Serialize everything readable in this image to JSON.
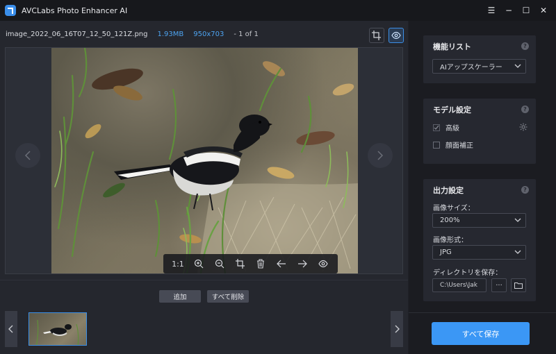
{
  "app": {
    "title": "AVCLabs Photo Enhancer AI"
  },
  "window": {
    "menu": "☰",
    "minimize": "−",
    "maximize": "☐",
    "close": "✕"
  },
  "file": {
    "name": "image_2022_06_16T07_12_50_121Z.png",
    "size": "1.93MB",
    "dimensions": "950x703",
    "count": "- 1 of 1"
  },
  "toolbar": {
    "ratio": "1:1"
  },
  "actions": {
    "add": "追加",
    "delete_all": "すべて削除"
  },
  "panel": {
    "features": {
      "title": "機能リスト",
      "help": "?",
      "selected": "AIアップスケーラー"
    },
    "model": {
      "title": "モデル設定",
      "help": "?",
      "high": "高級",
      "face": "顔面補正"
    },
    "output": {
      "title": "出力設定",
      "help": "?",
      "size_label": "画像サイズ：",
      "size_value": "200%",
      "format_label": "画像形式：",
      "format_value": "JPG",
      "dir_label": "ディレクトリを保存：",
      "dir_value": "C:\\Users\\Jak",
      "more": "···"
    },
    "save_all": "すべて保存"
  },
  "colors": {
    "accent": "#3b97f5",
    "link": "#4da3f0"
  }
}
